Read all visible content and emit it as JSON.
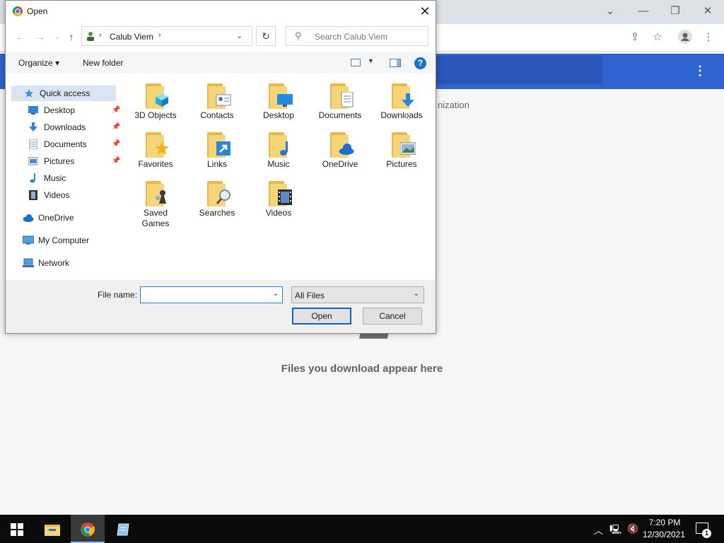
{
  "browser": {
    "downloads_header_partial": "nization",
    "empty_message": "Files you download appear here",
    "title_controls": {
      "minimize": "—",
      "restore": "❐",
      "close": "✕",
      "tab_dropdown": "⌄"
    },
    "toolbar_icons": [
      "share-icon",
      "star-icon",
      "profile-icon",
      "more-menu-icon"
    ],
    "header_color": "#2f63d0"
  },
  "dialog": {
    "title": "Open",
    "close_glyph": "✕",
    "address": {
      "location": "Calub Viem",
      "separator": "›"
    },
    "search": {
      "placeholder": "Search Calub Viem"
    },
    "commands": {
      "organize": "Organize ▾",
      "new_folder": "New folder"
    },
    "help_glyph": "?",
    "nav": {
      "quick_access": "Quick access",
      "items": [
        {
          "label": "Desktop",
          "pinned": true
        },
        {
          "label": "Downloads",
          "pinned": true
        },
        {
          "label": "Documents",
          "pinned": true
        },
        {
          "label": "Pictures",
          "pinned": true
        },
        {
          "label": "Music",
          "pinned": false
        },
        {
          "label": "Videos",
          "pinned": false
        }
      ],
      "onedrive": "OneDrive",
      "my_computer": "My Computer",
      "network": "Network"
    },
    "folders": [
      {
        "name": "3D Objects",
        "icon": "cube-icon"
      },
      {
        "name": "Contacts",
        "icon": "contact-card-icon"
      },
      {
        "name": "Desktop",
        "icon": "monitor-icon"
      },
      {
        "name": "Documents",
        "icon": "document-icon"
      },
      {
        "name": "Downloads",
        "icon": "download-arrow-icon"
      },
      {
        "name": "Favorites",
        "icon": "star-icon"
      },
      {
        "name": "Links",
        "icon": "link-arrow-icon"
      },
      {
        "name": "Music",
        "icon": "music-note-icon"
      },
      {
        "name": "OneDrive",
        "icon": "cloud-icon"
      },
      {
        "name": "Pictures",
        "icon": "picture-icon"
      },
      {
        "name": "Saved\nGames",
        "icon": "chess-piece-icon"
      },
      {
        "name": "Searches",
        "icon": "magnifier-icon"
      },
      {
        "name": "Videos",
        "icon": "film-icon"
      }
    ],
    "file_name_label": "File name:",
    "file_name_value": "",
    "file_type": "All Files",
    "open_button": "Open",
    "cancel_button": "Cancel"
  },
  "taskbar": {
    "time": "7:20 PM",
    "date": "12/30/2021",
    "notification_count": "1",
    "apps": [
      "windows-start",
      "file-explorer",
      "chrome",
      "notepad"
    ]
  }
}
